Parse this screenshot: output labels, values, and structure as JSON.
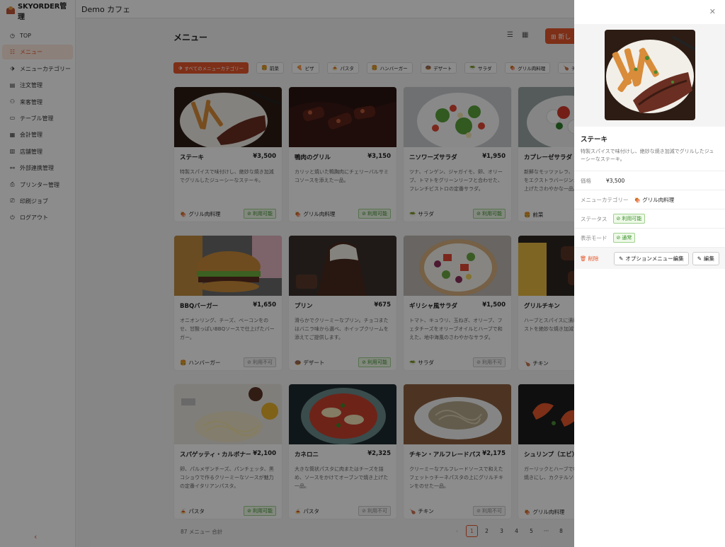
{
  "brand": {
    "name": "SKYORDER管理"
  },
  "topbar": {
    "title": "Demo カフェ"
  },
  "sidebar": {
    "items": [
      {
        "label": "TOP",
        "icon": "clock"
      },
      {
        "label": "メニュー",
        "icon": "list"
      },
      {
        "label": "メニューカテゴリー",
        "icon": "tag"
      },
      {
        "label": "注文管理",
        "icon": "clipboard"
      },
      {
        "label": "来客管理",
        "icon": "user"
      },
      {
        "label": "テーブル管理",
        "icon": "table"
      },
      {
        "label": "会計管理",
        "icon": "calculator"
      },
      {
        "label": "店舗管理",
        "icon": "store"
      },
      {
        "label": "外部連携管理",
        "icon": "link"
      },
      {
        "label": "プリンター管理",
        "icon": "printer"
      },
      {
        "label": "印刷ジョブ",
        "icon": "print-job"
      },
      {
        "label": "ログアウト",
        "icon": "logout"
      }
    ],
    "active_index": 1
  },
  "main": {
    "title": "メニュー",
    "new_button": "新し",
    "filters": [
      {
        "label": "すべてのメニューカテゴリー",
        "icon": "tag"
      },
      {
        "label": "前菜",
        "icon": "appetizer"
      },
      {
        "label": "ピザ",
        "icon": "pizza"
      },
      {
        "label": "パスタ",
        "icon": "pasta"
      },
      {
        "label": "ハンバーガー",
        "icon": "burger"
      },
      {
        "label": "デザート",
        "icon": "dessert"
      },
      {
        "label": "サラダ",
        "icon": "salad"
      },
      {
        "label": "グリル肉料理",
        "icon": "grill"
      },
      {
        "label": "チキン",
        "icon": "chicken"
      }
    ],
    "cards": [
      {
        "name": "ステーキ",
        "price": "¥3,500",
        "desc": "特製スパイスで味付けし、絶妙な焼き加減でグリルしたジューシーなステーキ。",
        "category": "グリル肉料理",
        "status": "利用可能",
        "ok": true,
        "img": "steak"
      },
      {
        "name": "鴨肉のグリル",
        "price": "¥3,150",
        "desc": "カリッと焼いた鴨胸肉にチェリーバルサミコソースを添えた一品。",
        "category": "グリル肉料理",
        "status": "利用可能",
        "ok": true,
        "img": "duck"
      },
      {
        "name": "ニソワーズサラダ",
        "price": "¥1,950",
        "desc": "ツナ、インゲン、ジャガイモ、卵、オリーブ、トマトをグリーンリーフと合わせた、フレンチビストロの定番サラダ。",
        "category": "サラダ",
        "status": "利用可能",
        "ok": true,
        "img": "salad"
      },
      {
        "name": "カプレーゼサラダ",
        "price": "",
        "desc": "新鮮なモッツァレラ、トマト、バジルの葉をエクストラバージンオリーブオイルで仕上げたさわやかな一品。",
        "category": "前菜",
        "status": "",
        "ok": true,
        "img": "caprese"
      },
      {
        "name": "BBQバーガー",
        "price": "¥1,650",
        "desc": "オニオンリング、チーズ、ベーコンをのせ、甘酸っぱいBBQソースで仕上げたバーガー。",
        "category": "ハンバーガー",
        "status": "利用不可",
        "ok": false,
        "img": "burger"
      },
      {
        "name": "プリン",
        "price": "¥675",
        "desc": "滑らかでクリーミーなプリン。チョコまたはバニラ味から選べ、ホイップクリームを添えてご提供します。",
        "category": "デザート",
        "status": "利用可能",
        "ok": true,
        "img": "pudding"
      },
      {
        "name": "ギリシャ風サラダ",
        "price": "¥1,500",
        "desc": "トマト、キュウリ、玉ねぎ、オリーブ、フェタチーズをオリーブオイルとハーブで和えた、地中海風のさわやかなサラダ。",
        "category": "サラダ",
        "status": "利用不可",
        "ok": false,
        "img": "greek"
      },
      {
        "name": "グリルチキン",
        "price": "",
        "desc": "ハーブとスパイスに漬け込んだチキンブレストを絶妙な焼き加減でグリルしました。",
        "category": "チキン",
        "status": "",
        "ok": true,
        "img": "chicken"
      },
      {
        "name": "スパゲッティ・カルボナーラ",
        "price": "¥2,100",
        "desc": "卵、パルメザンチーズ、パンチェッタ、黒コショウで作るクリーミーなソースが魅力の定番イタリアンパスタ。",
        "category": "パスタ",
        "status": "利用可能",
        "ok": true,
        "img": "carbonara"
      },
      {
        "name": "カネロニ",
        "price": "¥2,325",
        "desc": "大きな筒状パスタに肉またはチーズを詰め、ソースをかけてオーブンで焼き上げた一品。",
        "category": "パスタ",
        "status": "利用不可",
        "ok": false,
        "img": "cannelloni"
      },
      {
        "name": "チキン・アルフレードパスタ",
        "price": "¥2,175",
        "desc": "クリーミーなアルフレードソースで和えたフェットゥチーネパスタの上にグリルチキンをのせた一品。",
        "category": "チキン",
        "status": "利用不可",
        "ok": false,
        "img": "alfredo"
      },
      {
        "name": "シュリンプ（エビ）",
        "price": "",
        "desc": "ガーリックとハーブで味付けしたエビを串焼きにし、カクテルソースを添えて。",
        "category": "グリル肉料理",
        "status": "",
        "ok": true,
        "img": "shrimp"
      }
    ],
    "footer_count": "87 メニュー 合計",
    "pagination": [
      "1",
      "2",
      "3",
      "4",
      "5",
      "···",
      "8"
    ]
  },
  "drawer": {
    "title": "ステーキ",
    "desc": "特製スパイスで味付けし、絶妙な焼き加減でグリルしたジューシーなステーキ。",
    "price_label": "価格",
    "price_value": "¥3,500",
    "category_label": "メニューカテゴリー",
    "category_value": "グリル肉料理",
    "status_label": "ステータス",
    "status_value": "利用可能",
    "mode_label": "表示モード",
    "mode_value": "通常",
    "delete_label": "削除",
    "option_edit_label": "オプションメニュー編集",
    "edit_label": "編集"
  },
  "colors": {
    "accent": "#e5572b",
    "success": "#3a8f2a"
  }
}
